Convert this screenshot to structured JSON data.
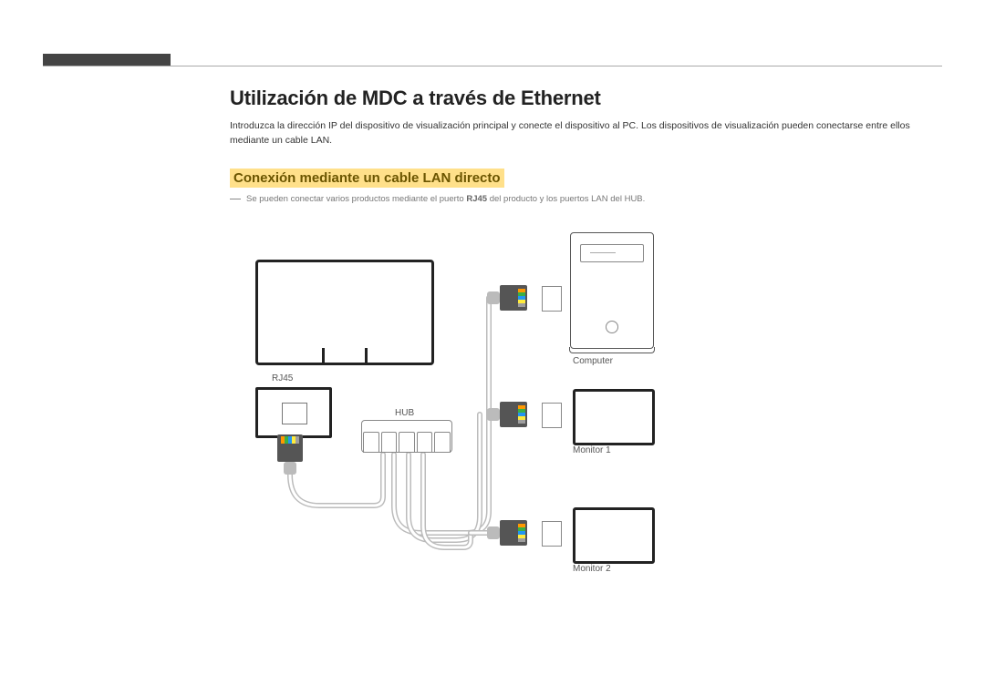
{
  "title": "Utilización de MDC a través de Ethernet",
  "intro": "Introduzca la dirección IP del dispositivo de visualización principal y conecte el dispositivo al PC. Los dispositivos de visualización pueden conectarse entre ellos mediante un cable LAN.",
  "subheading": "Conexión mediante un cable LAN directo",
  "note_prefix": "Se pueden conectar varios productos mediante el puerto ",
  "note_bold": "RJ45",
  "note_suffix": " del producto y los puertos LAN del HUB.",
  "labels": {
    "rj45": "RJ45",
    "hub": "HUB",
    "computer": "Computer",
    "monitor1": "Monitor 1",
    "monitor2": "Monitor 2"
  }
}
